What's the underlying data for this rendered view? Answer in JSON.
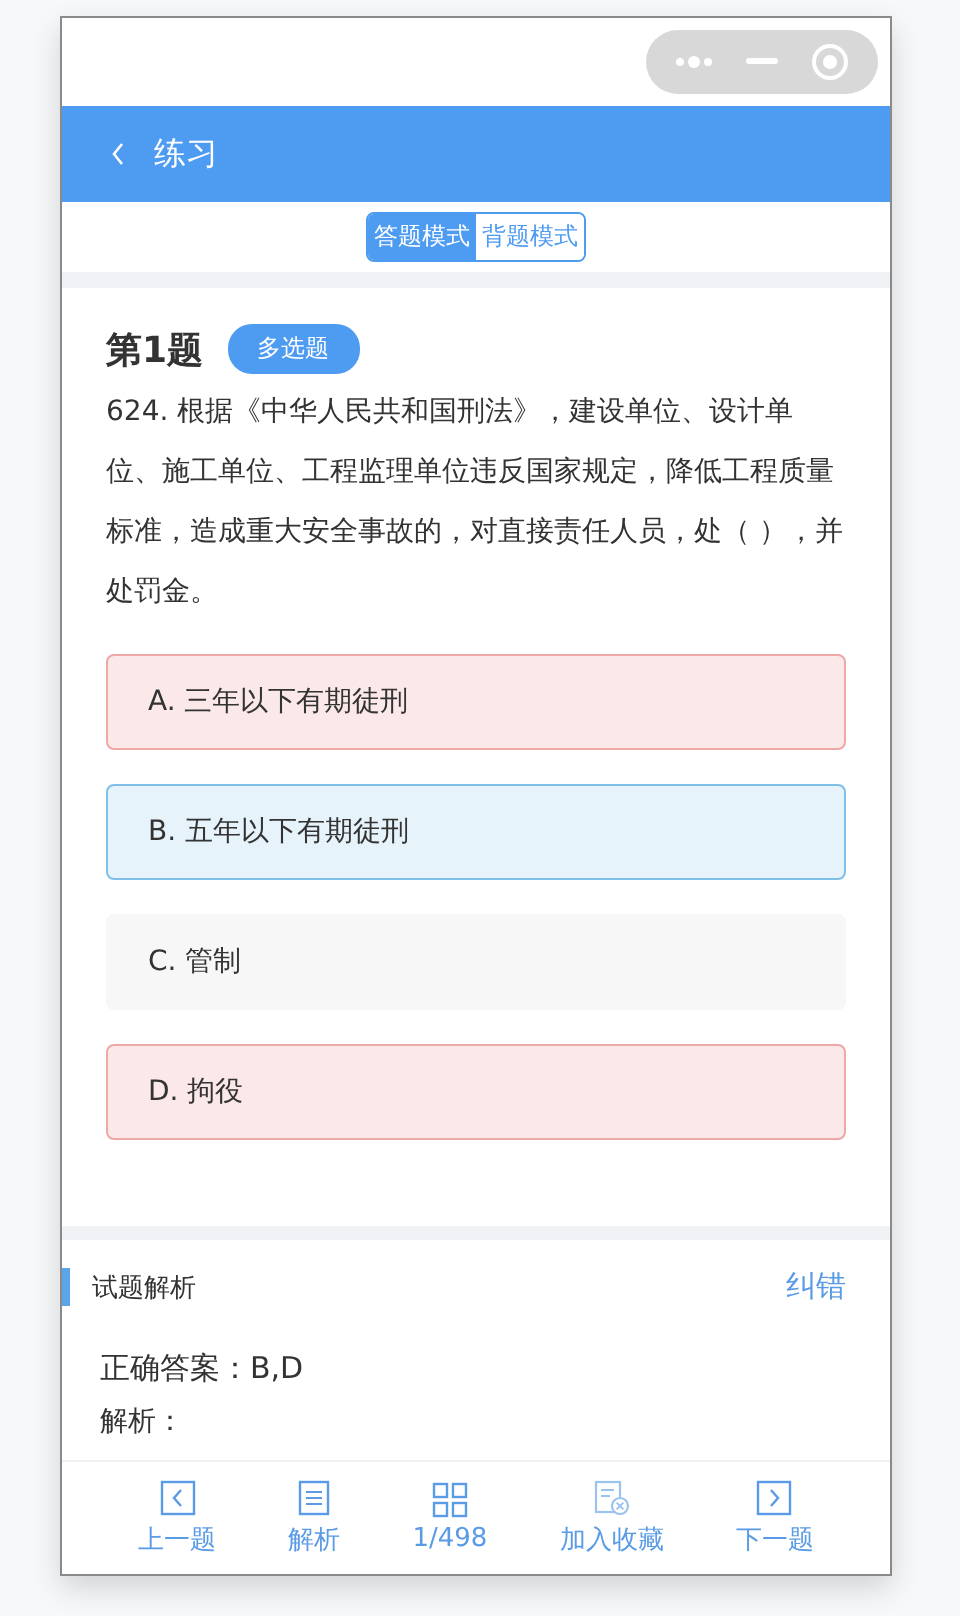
{
  "nav": {
    "title": "练习"
  },
  "modes": [
    {
      "label": "答题模式",
      "selected": true
    },
    {
      "label": "背题模式",
      "selected": false
    }
  ],
  "question": {
    "number": "第1题",
    "type_badge": "多选题",
    "text": "624. 根据《中华人民共和国刑法》，建设单位、设计单位、施工单位、工程监理单位违反国家规定，降低工程质量标准，造成重大安全事故的，对直接责任人员，处（ ），并处罚金。"
  },
  "options": [
    {
      "label": "A. 三年以下有期徒刑",
      "wrong": true,
      "correct": false
    },
    {
      "label": "B. 五年以下有期徒刑",
      "wrong": false,
      "correct": true
    },
    {
      "label": "C. 管制",
      "wrong": false,
      "correct": false
    },
    {
      "label": "D. 拘役",
      "wrong": true,
      "correct": false
    }
  ],
  "analysis": {
    "title": "试题解析",
    "report": "纠错",
    "answer": "正确答案：B,D",
    "explanation_label": "解析："
  },
  "bottom_bar": [
    {
      "kind": "prev",
      "label": "上一题"
    },
    {
      "kind": "analysis",
      "label": "解析"
    },
    {
      "kind": "grid",
      "label": "1/498"
    },
    {
      "kind": "favorite",
      "label": "加入收藏"
    },
    {
      "kind": "next",
      "label": "下一题"
    }
  ]
}
